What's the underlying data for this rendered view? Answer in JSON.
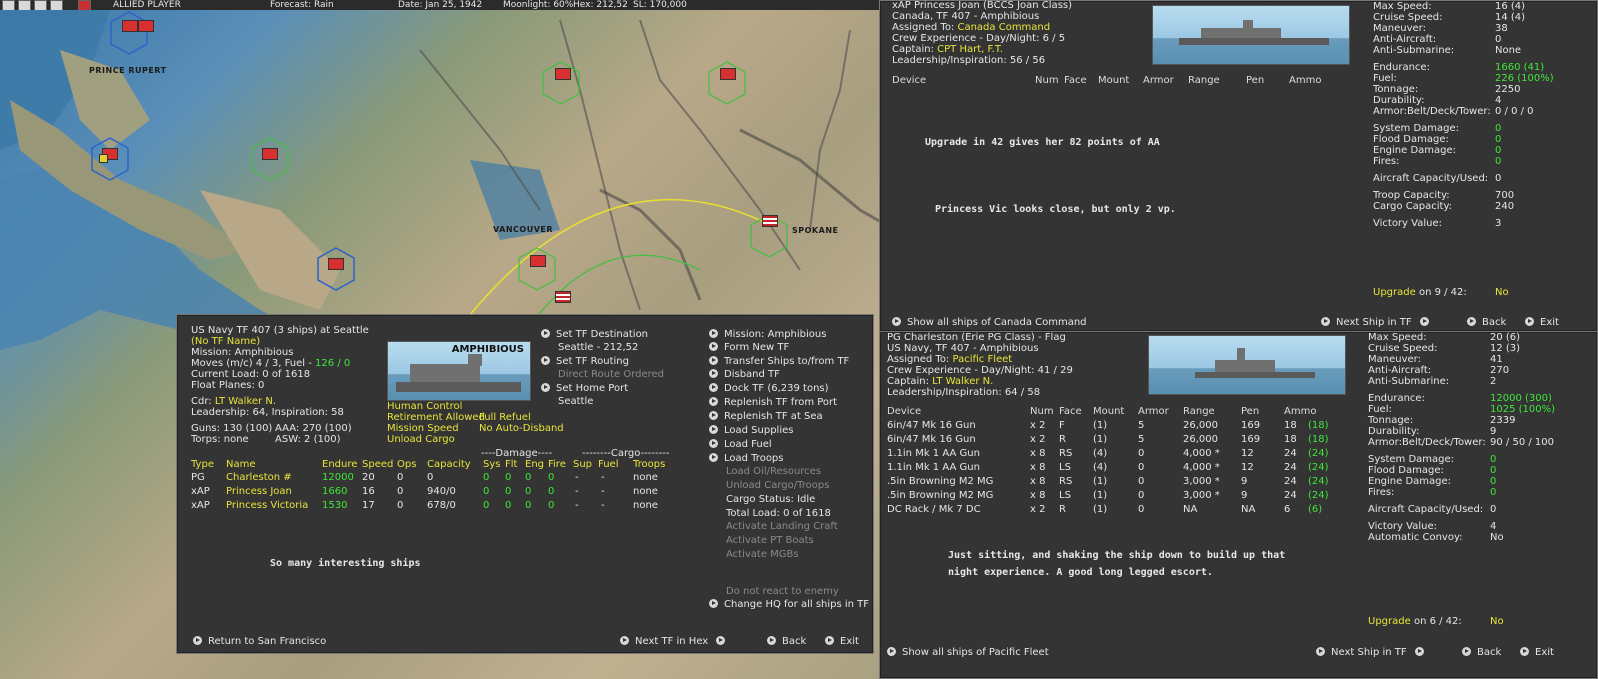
{
  "topbar": {
    "player": "ALLIED PLAYER",
    "forecast": "Forecast: Rain",
    "date": "Date: Jan 25, 1942",
    "moonlight": "Moonlight: 60%",
    "hex": "Hex: 212,52",
    "sl": "SL: 170,000"
  },
  "map_labels": {
    "prince_rupert": "PRINCE RUPERT",
    "vancouver": "VANCOUVER",
    "spokane": "SPOKANE"
  },
  "tf": {
    "title": "US Navy TF 407 (3 ships) at Seattle",
    "name": "(No TF Name)",
    "mission": "Mission: Amphibious",
    "moves": "Moves (m/c)  4 / 3, Fuel - ",
    "fuel": "126 / 0",
    "load": "Current Load:  0 of 1618",
    "float": "Float Planes: 0",
    "cdr_label": "Cdr: ",
    "cdr": "LT Walker N.",
    "leadership": "Leadership: 64, Inspiration: 58",
    "guns": "Guns: 130 (100)",
    "aaa": "AAA: 270 (100)",
    "torps": "Torps: none",
    "asw": "ASW: 2 (100)",
    "image_label": "AMPHIBIOUS",
    "human_control": "Human Control",
    "retire": "Retirement Allowed",
    "refuel": "Full Refuel",
    "mission_speed": "Mission Speed",
    "no_disband": "No Auto-Disband",
    "unload": "Unload Cargo",
    "mid_buttons": [
      "Set TF Destination",
      "Seattle - 212,52",
      "Set TF Routing",
      "Direct Route Ordered",
      "Set Home Port",
      "Seattle"
    ],
    "right_buttons": [
      "Mission: Amphibious",
      "Form New TF",
      "Transfer Ships to/from TF",
      "Disband TF",
      "Dock TF (6,239 tons)",
      "Replenish TF from Port",
      "Replenish TF at Sea",
      "Load Supplies",
      "Load Fuel",
      "Load Troops",
      "Load Oil/Resources",
      "Unload Cargo/Troops",
      "Cargo Status: Idle",
      "Total Load: 0 of 1618",
      "Activate Landing Craft",
      "Activate PT Boats",
      "Activate MGBs",
      "Do not react to enemy",
      "Change HQ for all ships in TF"
    ],
    "damage_hdr": "----Damage----",
    "cargo_hdr": "--------Cargo--------",
    "cols": [
      "Type",
      "Name",
      "Endure",
      "Speed",
      "Ops",
      "Capacity",
      "Sys",
      "Flt",
      "Eng",
      "Fire",
      "Sup",
      "Fuel",
      "Troops"
    ],
    "rows": [
      [
        "PG",
        "Charleston #",
        "12000",
        "20",
        "0",
        "0",
        "0",
        "0",
        "0",
        "0",
        "-",
        "-",
        "none"
      ],
      [
        "xAP",
        "Princess Joan",
        "1660",
        "16",
        "0",
        "940/0",
        "0",
        "0",
        "0",
        "0",
        "-",
        "-",
        "none"
      ],
      [
        "xAP",
        "Princess Victoria",
        "1530",
        "17",
        "0",
        "678/0",
        "0",
        "0",
        "0",
        "0",
        "-",
        "-",
        "none"
      ]
    ],
    "note": "So many interesting ships",
    "bottom": [
      "Return to San Francisco",
      "Next TF in Hex",
      "Back",
      "Exit"
    ]
  },
  "joan": {
    "l1": "xAP Princess Joan (BCCS Joan Class)",
    "l2": "Canada, TF 407 - Amphibious",
    "assigned_label": "Assigned To:  ",
    "assigned": "Canada Command",
    "crew": "Crew Experience - Day/Night:  6 / 5",
    "captain_label": "Captain:  ",
    "captain": "CPT Hart, F.T.",
    "lead": "Leadership/Inspiration: 56 / 56",
    "cols": [
      "Device",
      "Num",
      "Face",
      "Mount",
      "Armor",
      "Range",
      "Pen",
      "Ammo"
    ],
    "note1": "Upgrade in 42 gives her 82 points of AA",
    "note2": "Princess Vic looks close, but only 2 vp.",
    "stats": [
      [
        "Max Speed:",
        "16 (4)",
        "w"
      ],
      [
        "Cruise Speed:",
        "14 (4)",
        "w"
      ],
      [
        "Maneuver:",
        "38",
        "w"
      ],
      [
        "Anti-Aircraft:",
        "0",
        "w"
      ],
      [
        "Anti-Submarine:",
        "None",
        "w"
      ],
      [
        "Endurance:",
        "1660 (41)",
        "g"
      ],
      [
        "Fuel:",
        "226 (100%)",
        "g"
      ],
      [
        "Tonnage:",
        "2250",
        "w"
      ],
      [
        "Durability:",
        "4",
        "w"
      ],
      [
        "Armor:Belt/Deck/Tower:",
        "0 / 0 / 0",
        "w"
      ],
      [
        "System Damage:",
        "0",
        "g"
      ],
      [
        "Flood Damage:",
        "0",
        "g"
      ],
      [
        "Engine Damage:",
        "0",
        "g"
      ],
      [
        "Fires:",
        "0",
        "g"
      ],
      [
        "Aircraft Capacity/Used:",
        "0",
        "w"
      ],
      [
        "Troop Capacity:",
        "700",
        "w"
      ],
      [
        "Cargo Capacity:",
        "240",
        "w"
      ],
      [
        "Victory Value:",
        "3",
        "w"
      ]
    ],
    "upgrade_label": "Upgrade",
    "upgrade_on": "on  9 / 42:",
    "upgrade_val": "No",
    "bottom": [
      "Show all ships of Canada Command",
      "Next Ship in TF",
      "Back",
      "Exit"
    ]
  },
  "charleston": {
    "l1": "PG Charleston (Erie PG Class) - Flag",
    "l2": "US Navy, TF 407 - Amphibious",
    "assigned_label": "Assigned To:  ",
    "assigned": "Pacific Fleet",
    "crew": "Crew Experience - Day/Night:  41 / 29",
    "captain_label": "Captain:  ",
    "captain": "LT Walker N.",
    "lead": "Leadership/Inspiration: 64 / 58",
    "cols": [
      "Device",
      "Num",
      "Face",
      "Mount",
      "Armor",
      "Range",
      "Pen",
      "Ammo"
    ],
    "rows": [
      [
        "6in/47 Mk 16 Gun",
        "x 2",
        "F",
        "(1)",
        "5",
        "26,000",
        "169",
        "18",
        "(18)"
      ],
      [
        "6in/47 Mk 16 Gun",
        "x 2",
        "R",
        "(1)",
        "5",
        "26,000",
        "169",
        "18",
        "(18)"
      ],
      [
        "1.1in Mk 1 AA Gun",
        "x 8",
        "RS",
        "(4)",
        "0",
        "4,000 *",
        "12",
        "24",
        "(24)"
      ],
      [
        "1.1in Mk 1 AA Gun",
        "x 8",
        "LS",
        "(4)",
        "0",
        "4,000 *",
        "12",
        "24",
        "(24)"
      ],
      [
        ".5in Browning M2 MG",
        "x 8",
        "RS",
        "(1)",
        "0",
        "3,000 *",
        "9",
        "24",
        "(24)"
      ],
      [
        ".5in Browning M2 MG",
        "x 8",
        "LS",
        "(1)",
        "0",
        "3,000 *",
        "9",
        "24",
        "(24)"
      ],
      [
        "DC Rack / Mk 7 DC",
        "x 2",
        "R",
        "(1)",
        "0",
        "NA",
        "NA",
        "6",
        "(6)"
      ]
    ],
    "note1": "Just sitting, and shaking the ship down to build up that",
    "note2": "night experience.  A good long legged escort.",
    "stats": [
      [
        "Max Speed:",
        "20 (6)",
        "w"
      ],
      [
        "Cruise Speed:",
        "12 (3)",
        "w"
      ],
      [
        "Maneuver:",
        "41",
        "w"
      ],
      [
        "Anti-Aircraft:",
        "270",
        "w"
      ],
      [
        "Anti-Submarine:",
        "2",
        "w"
      ],
      [
        "Endurance:",
        "12000 (300)",
        "g"
      ],
      [
        "Fuel:",
        "1025 (100%)",
        "g"
      ],
      [
        "Tonnage:",
        "2339",
        "w"
      ],
      [
        "Durability:",
        "9",
        "w"
      ],
      [
        "Armor:Belt/Deck/Tower:",
        "90 / 50 / 100",
        "w"
      ],
      [
        "System Damage:",
        "0",
        "g"
      ],
      [
        "Flood Damage:",
        "0",
        "g"
      ],
      [
        "Engine Damage:",
        "0",
        "g"
      ],
      [
        "Fires:",
        "0",
        "g"
      ],
      [
        "Aircraft Capacity/Used:",
        "0",
        "w"
      ],
      [
        "Victory Value:",
        "4",
        "w"
      ],
      [
        "Automatic Convoy:",
        "No",
        "w"
      ]
    ],
    "upgrade_label": "Upgrade",
    "upgrade_on": "on  6 / 42:",
    "upgrade_val": "No",
    "bottom": [
      "Show all ships of Pacific Fleet",
      "Next Ship in TF",
      "Back",
      "Exit"
    ]
  }
}
